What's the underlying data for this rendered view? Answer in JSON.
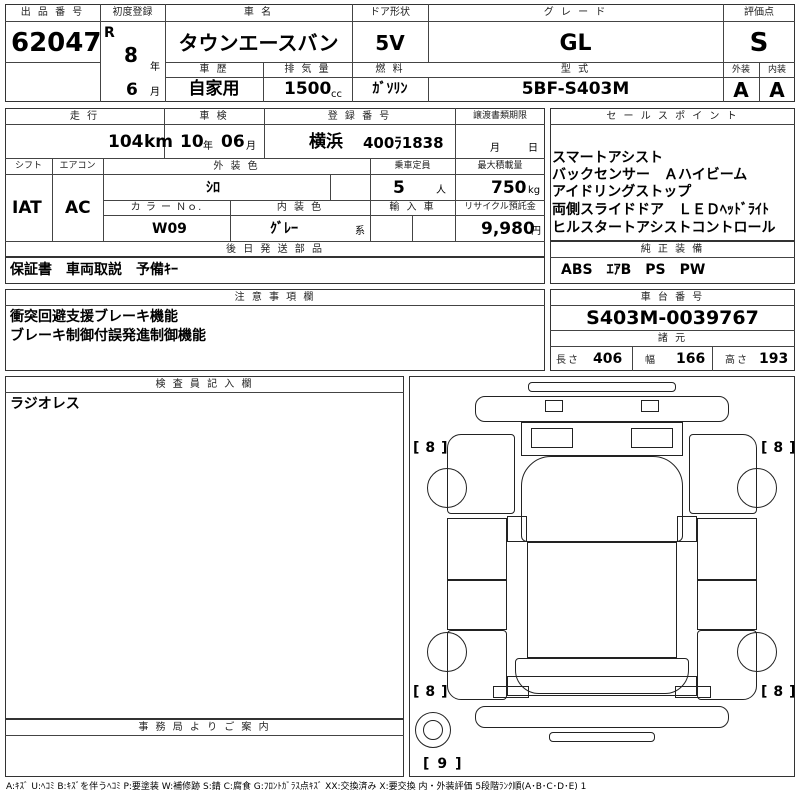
{
  "labels": {
    "lot_no": "出 品 番 号",
    "first_reg": "初度登録",
    "car_name": "車 名",
    "door_type": "ドア形状",
    "grade": "グ レ ー ド",
    "score": "評価点",
    "history": "車 歴",
    "displacement": "排 気 量",
    "fuel": "燃 料",
    "model": "型 式",
    "exterior": "外装",
    "interior": "内装",
    "year_unit": "年",
    "month_unit": "月",
    "mileage": "走 行",
    "inspection": "車 検",
    "reg_no": "登 録 番 号",
    "transfer_deadline": "譲渡書類期限",
    "sales_points": "セ ー ル ス ポ イ ン ト",
    "shift": "シフト",
    "aircon": "エアコン",
    "ext_color": "外 装 色",
    "capacity": "乗車定員",
    "max_load": "最大積載量",
    "color_no": "カ ラ ー Ｎｏ.",
    "int_color": "内 装 色",
    "import": "輸 入 車",
    "recycle": "リサイクル預託金",
    "later_parts": "後 日 発 送 部 品",
    "genuine_equip": "純 正 装 備",
    "notes": "注 意 事 項 欄",
    "chassis_no": "車 台 番 号",
    "specs": "諸 元",
    "inspector": "検 査 員 記 入 欄",
    "office": "事 務 局 よ り ご 案 内",
    "length": "長さ",
    "width": "幅",
    "height": "高さ",
    "insp_year_unit": "年",
    "insp_month_unit": "月",
    "deadline_month_unit": "月",
    "deadline_day_unit": "日",
    "km_unit": "km",
    "cc_unit": "cc",
    "person_unit": "人",
    "kg_unit": "kg",
    "yen_unit": "円",
    "series_unit": "系"
  },
  "values": {
    "lot_no": "62047",
    "era": "R",
    "year": "8",
    "month": "6",
    "car_name": "タウンエースバン",
    "door_type": "5V",
    "grade": "GL",
    "score": "S",
    "history": "自家用",
    "displacement": "1500",
    "fuel": "ｶﾞｿﾘﾝ",
    "model": "5BF-S403M",
    "exterior": "A",
    "interior": "A",
    "mileage": "104",
    "insp_year": "10",
    "insp_month": "06",
    "reg_area": "横浜",
    "reg_no": "400ﾗ1838",
    "shift": "IAT",
    "aircon": "AC",
    "ext_color": "ｼﾛ",
    "capacity": "5",
    "max_load": "750",
    "color_no": "W09",
    "int_color": "ｸﾞﾚｰ",
    "recycle": "9,980",
    "sales_points": [
      "スマートアシスト",
      "バックセンサー　Ａハイビーム",
      "アイドリングストップ",
      "両側スライドドア　ＬＥＤﾍｯﾄﾞﾗｲﾄ",
      "ヒルスタートアシストコントロール"
    ],
    "later_parts": "保証書　車両取説　予備ｷｰ",
    "genuine_equip": "ABS　ｴｱB　PS　PW",
    "notes": [
      "衝突回避支援ブレーキ機能",
      "ブレーキ制御付誤発進制御機能"
    ],
    "chassis_no": "S403M-0039767",
    "length": "406",
    "width": "166",
    "height": "193",
    "inspector_note": "ラジオレス",
    "tire_fl": "8",
    "tire_fr": "8",
    "tire_rl": "8",
    "tire_rr": "8",
    "spare": "9"
  },
  "legend": "A:ｷｽﾞ U:ﾍｺﾐ B:ｷｽﾞを伴うﾍｺﾐ P:要塗装 W:補修跡 S:錆 C:腐食 G:ﾌﾛﾝﾄｶﾞﾗｽ点ｷｽﾞ XX:交換済み X:要交換 内・外装評価 5段階ﾗﾝｸ順(A･B･C･D･E) 1"
}
